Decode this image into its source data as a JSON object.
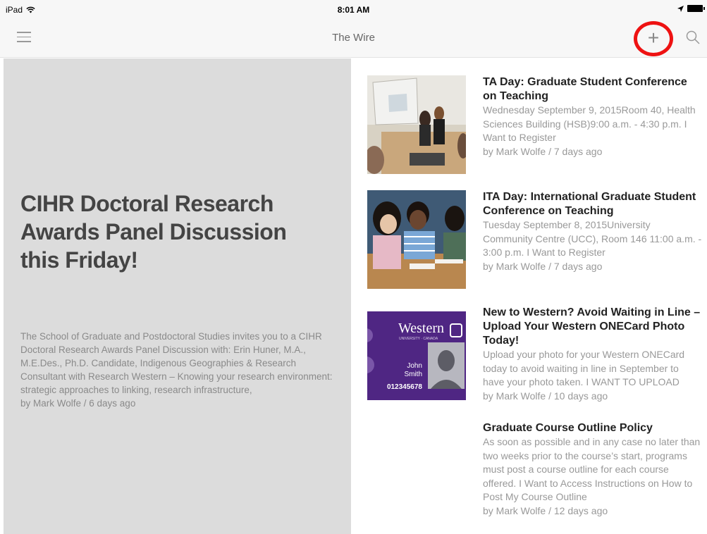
{
  "status_bar": {
    "device": "iPad",
    "time": "8:01 AM"
  },
  "nav": {
    "title": "The Wire",
    "menu_icon": "hamburger-menu-icon",
    "add_icon": "plus-icon",
    "add_glyph": "+",
    "search_icon": "search-icon",
    "highlight_color": "#ee1212"
  },
  "featured": {
    "title": "CIHR Doctoral Research Awards Panel Discussion this Friday!",
    "summary": "The School of Graduate and Postdoctoral Studies invites you to a CIHR Doctoral Research Awards Panel Discussion with: Erin Huner, M.A., M.E.Des., Ph.D. Candidate, Indigenous Geographies & Research Consultant with Research Western – Knowing your research environment: strategic approaches to linking, research infrastructure,",
    "byline": "by Mark Wolfe / 6 days ago"
  },
  "articles": [
    {
      "title": "TA Day: Graduate Student Conference on Teaching",
      "summary": "Wednesday September 9, 2015Room 40, Health Sciences Building (HSB)9:00 a.m. - 4:30 p.m. I Want to Register",
      "byline": "by Mark Wolfe / 7 days ago"
    },
    {
      "title": "ITA Day: International Graduate Student Conference on Teaching",
      "summary": "Tuesday September 8, 2015University Community Centre (UCC), Room 146 11:00 a.m. - 3:00 p.m. I Want to Register",
      "byline": "by Mark Wolfe / 7 days ago"
    },
    {
      "title": "New to Western? Avoid Waiting in Line – Upload Your Western ONECard Photo Today!",
      "summary": "Upload your photo for your Western ONECard today to avoid waiting in line in September to have your photo taken. I WANT TO UPLOAD",
      "byline": "by Mark Wolfe / 10 days ago"
    },
    {
      "title": "Graduate Course Outline Policy",
      "summary": "As soon as possible and in any case no later than two weeks prior to the course’s start, programs must post a course outline for each course offered. I Want to Access Instructions on How to Post My Course Outline",
      "byline": "by Mark Wolfe / 12 days ago"
    }
  ],
  "card": {
    "brand": "Western",
    "subtitle": "UNIVERSITY · CANADA",
    "first_name": "John",
    "last_name": "Smith",
    "number": "012345678",
    "color": "#4f2683"
  }
}
